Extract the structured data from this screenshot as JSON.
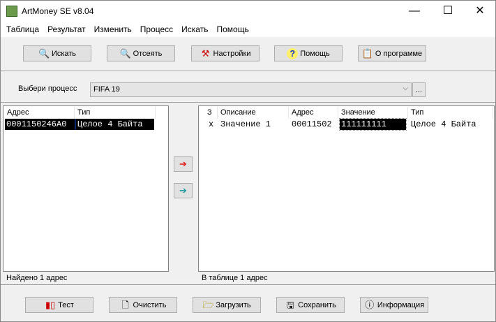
{
  "window": {
    "title": "ArtMoney SE v8.04",
    "minimize": "—",
    "maximize": "☐",
    "close": "✕"
  },
  "menu": [
    "Таблица",
    "Результат",
    "Изменить",
    "Процесс",
    "Искать",
    "Помощь"
  ],
  "toolbar": {
    "search": "Искать",
    "filter": "Отсеять",
    "settings": "Настройки",
    "help": "Помощь",
    "about": "О программе"
  },
  "process": {
    "label": "Выбери процесс",
    "value": "FIFA 19",
    "browse": "..."
  },
  "left_table": {
    "headers": [
      "Адрес",
      "Тип"
    ],
    "rows": [
      [
        "0001150246A0",
        "Целое 4 Байта"
      ]
    ],
    "status": "Найдено 1 адрес"
  },
  "right_table": {
    "headers": [
      "З",
      "Описание",
      "Адрес",
      "Значение",
      "Тип"
    ],
    "rows": [
      [
        "x",
        "Значение 1",
        "00011502",
        "111111111",
        "Целое 4 Байта"
      ]
    ],
    "status": "В таблице 1 адрес"
  },
  "bottom": {
    "test": "Тест",
    "clear": "Очистить",
    "load": "Загрузить",
    "save": "Сохранить",
    "info": "Информация"
  }
}
